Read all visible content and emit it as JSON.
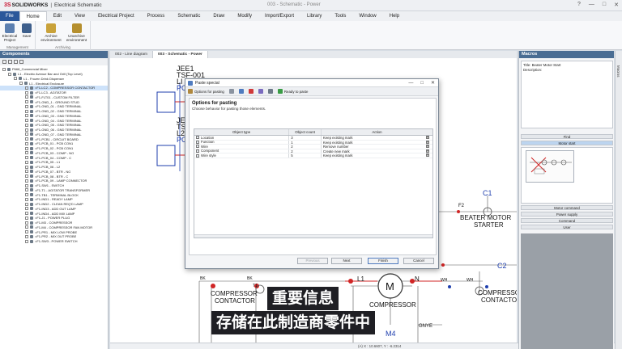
{
  "app": {
    "brand_ds": "3S",
    "brand_sw": "SOLIDWORKS",
    "brand_sep": "|",
    "brand_app": "Electrical Schematic",
    "document_title": "003 - Schematic - Power",
    "window_controls": [
      "?",
      "—",
      "□",
      "✕"
    ]
  },
  "menu": {
    "file": "File",
    "items": [
      "Home",
      "Edit",
      "View",
      "Electrical Project",
      "Process",
      "Schematic",
      "Draw",
      "Modify",
      "Import/Export",
      "Library",
      "Tools",
      "Window",
      "Help"
    ],
    "active": "Home"
  },
  "ribbon": {
    "groups": [
      {
        "label": "Management",
        "buttons": [
          "Electrical Project",
          "Save"
        ]
      },
      {
        "label": "Archiving",
        "buttons": [
          "Archive environment",
          "Unarchive environment"
        ]
      }
    ]
  },
  "components": {
    "title": "Components",
    "tree": [
      "P668_Commercial Mixer",
      "L1 - Electric Avenue Bar and Grill (Top Level)",
      "L1 - Frozen Drink Dispenser",
      "L1 - Electrical Enclosure",
      "=F1-LC2 - COMPRESSOR CONTACTOR",
      "=F1-LC3 - AGITATOR",
      "=F1-FLT01 - CUSTOM FILTER",
      "=F1-GND_1 - GROUND STUD",
      "=F1-GND_01 - GND TERMINAL",
      "=F1-GND_02 - GND TERMINAL",
      "=F1-GND_03 - GND TERMINAL",
      "=F1-GND_04 - GND TERMINAL",
      "=F1-GND_05 - GND TERMINAL",
      "=F1-GND_06 - GND TERMINAL",
      "=F1-GND_07 - GND TERMINAL",
      "=F1-PCB1 - CIRCUIT BOARD",
      "=F1-PCB_01 - PCB CON1",
      "=F1-PCB_02 - PCB CON1",
      "=F1-PCB_03 - COMP - NO",
      "=F1-PCB_04 - COMP - C",
      "=F1-PCB_05 - L1",
      "=F1-PCB_06 - L2",
      "=F1-PCB_07 - BTR - NO",
      "=F1-PCB_08 - BTR - C",
      "=F1-PCB_09 - LAMP CONNECTOR",
      "=F1-SW1 - SWITCH",
      "=F1-T1 - AGITATOR TRANSFORMER",
      "=F1-TB1 - TERMINAL BLOCK",
      "=F1-IND1 - READY LAMP",
      "=F1-IND2 - CLEAN REQ'D LAMP",
      "=F1-IND3 - ADD OUT LAMP",
      "=F1-IND4 - ADD MIX LAMP",
      "=F1-J1 - POWER PLUG",
      "=F1-M3 - COMPRESSOR",
      "=F1-M4 - COMPRESSOR FAN MOTOR",
      "=F1-PR1 - MIX LOW PROBE",
      "=F1-PR2 - MIX OUT PROBE",
      "=F1-SW3 - POWER SWITCH"
    ],
    "selected_index": 4
  },
  "doc_tabs": [
    "002 - Line diagram",
    "003 - Schematic - Power"
  ],
  "doc_tabs_active": 1,
  "schematic": {
    "top_labels": [
      "JEE1",
      "TSF-001",
      "LI",
      "PC",
      "JE",
      "TS",
      "L2",
      "PC"
    ],
    "c1": "C1",
    "c2": "C2",
    "f2": "F2",
    "beater_1": "BEATER MOTOR",
    "beater_2": "STARTER",
    "compressor_contactor_1_a": "COMPRESSOR",
    "compressor_contactor_1_b": "CONTACTOR",
    "compressor_contactor_2_a": "COMPRESSOR",
    "compressor_contactor_2_b": "CONTACTO",
    "compressor_motor": "COMPRESSOR",
    "motor_m": "M",
    "bk1": "BK",
    "bk2": "BK",
    "t1": "T1",
    "l1": "L1",
    "n": "N",
    "wh1": "WH",
    "wh2": "WH",
    "gnye": "GNYE",
    "m4": "M4"
  },
  "statusbar": "(A) X : 10.6607, Y : -6.2314",
  "macros": {
    "title": "Macros",
    "info_title": "Title: Beater Motor Start",
    "info_desc": "Description:",
    "categories_top": [
      "Find",
      "Motor start"
    ],
    "active_category": "Motor start",
    "categories_bottom": [
      "Motor command",
      "Power supply",
      "Command",
      "User"
    ],
    "side_tab": "Macros"
  },
  "dialog": {
    "title": "Paste special",
    "toolbar": [
      "Options for pasting",
      "Ready to paste"
    ],
    "heading": "Options for pasting",
    "subheading": "Choose behavior for pasting those elements.",
    "columns": [
      "Object type",
      "Object count",
      "Action"
    ],
    "rows": [
      {
        "type": "Location",
        "count": "3",
        "action": "Keep existing mark"
      },
      {
        "type": "Function",
        "count": "1",
        "action": "Keep existing mark"
      },
      {
        "type": "Wire",
        "count": "2",
        "action": "Remove number"
      },
      {
        "type": "Component",
        "count": "2",
        "action": "Create new mark"
      },
      {
        "type": "Wire style",
        "count": "5",
        "action": "Keep existing mark"
      }
    ],
    "buttons": [
      "Previous",
      "Next",
      "Finish",
      "Cancel"
    ]
  },
  "subtitle": {
    "line1": "重要信息",
    "line2": "存储在此制造商零件中"
  },
  "colors": {
    "file_menu": "#2b579a",
    "panel_head": "#4a6d93",
    "wire_red": "#d02525",
    "schematic_blue": "#1f3fae"
  }
}
